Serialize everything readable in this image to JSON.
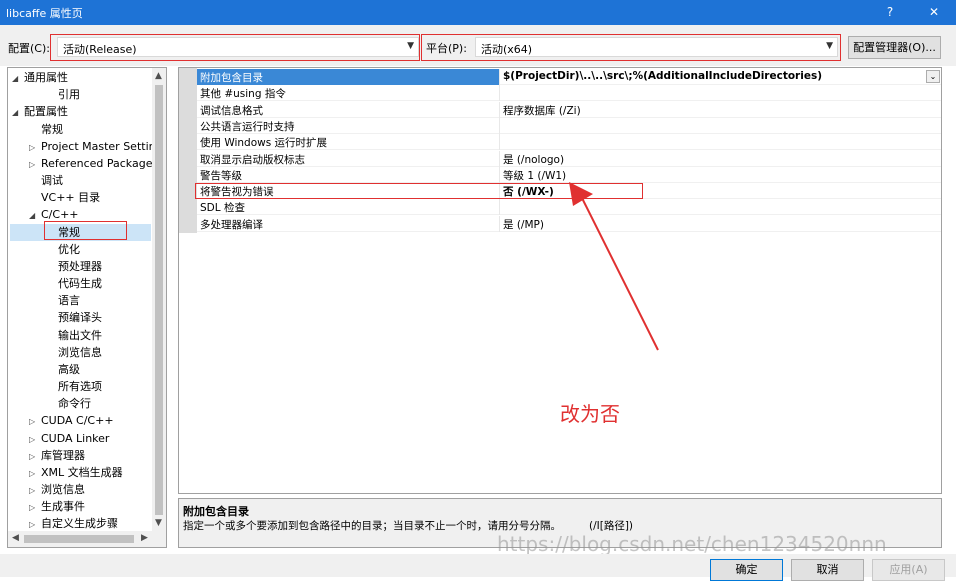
{
  "window": {
    "title": "libcaffe 属性页",
    "help_glyph": "?",
    "close_glyph": "✕"
  },
  "toolbar": {
    "config_label": "配置(C):",
    "config_value": "活动(Release)",
    "platform_label": "平台(P):",
    "platform_value": "活动(x64)",
    "config_manager_label": "配置管理器(O)..."
  },
  "tree": {
    "items": [
      {
        "label": "通用属性",
        "level": 0,
        "expander": "◢"
      },
      {
        "label": "引用",
        "level": 2,
        "expander": ""
      },
      {
        "label": "配置属性",
        "level": 0,
        "expander": "◢"
      },
      {
        "label": "常规",
        "level": 1,
        "expander": ""
      },
      {
        "label": "Project Master Settin",
        "level": 1,
        "expander": "▷"
      },
      {
        "label": "Referenced Packages",
        "level": 1,
        "expander": "▷"
      },
      {
        "label": "调试",
        "level": 1,
        "expander": ""
      },
      {
        "label": "VC++ 目录",
        "level": 1,
        "expander": ""
      },
      {
        "label": "C/C++",
        "level": 1,
        "expander": "◢"
      },
      {
        "label": "常规",
        "level": 2,
        "expander": "",
        "selected": true
      },
      {
        "label": "优化",
        "level": 2,
        "expander": ""
      },
      {
        "label": "预处理器",
        "level": 2,
        "expander": ""
      },
      {
        "label": "代码生成",
        "level": 2,
        "expander": ""
      },
      {
        "label": "语言",
        "level": 2,
        "expander": ""
      },
      {
        "label": "预编译头",
        "level": 2,
        "expander": ""
      },
      {
        "label": "输出文件",
        "level": 2,
        "expander": ""
      },
      {
        "label": "浏览信息",
        "level": 2,
        "expander": ""
      },
      {
        "label": "高级",
        "level": 2,
        "expander": ""
      },
      {
        "label": "所有选项",
        "level": 2,
        "expander": ""
      },
      {
        "label": "命令行",
        "level": 2,
        "expander": ""
      },
      {
        "label": "CUDA C/C++",
        "level": 1,
        "expander": "▷"
      },
      {
        "label": "CUDA Linker",
        "level": 1,
        "expander": "▷"
      },
      {
        "label": "库管理器",
        "level": 1,
        "expander": "▷"
      },
      {
        "label": "XML 文档生成器",
        "level": 1,
        "expander": "▷"
      },
      {
        "label": "浏览信息",
        "level": 1,
        "expander": "▷"
      },
      {
        "label": "生成事件",
        "level": 1,
        "expander": "▷"
      },
      {
        "label": "自定义生成步骤",
        "level": 1,
        "expander": "▷"
      }
    ]
  },
  "grid": {
    "rows": [
      {
        "name": "附加包含目录",
        "value": "$(ProjectDir)\\..\\..\\src\\;%(AdditionalIncludeDirectories)",
        "selected": true,
        "bold": true,
        "dropdown": "⌄"
      },
      {
        "name": "其他 #using 指令",
        "value": ""
      },
      {
        "name": "调试信息格式",
        "value": "程序数据库 (/Zi)"
      },
      {
        "name": "公共语言运行时支持",
        "value": ""
      },
      {
        "name": "使用 Windows 运行时扩展",
        "value": ""
      },
      {
        "name": "取消显示启动版权标志",
        "value": "是 (/nologo)"
      },
      {
        "name": "警告等级",
        "value": "等级 1 (/W1)"
      },
      {
        "name": "将警告视为错误",
        "value": "否 (/WX-)",
        "bold": true
      },
      {
        "name": "SDL 检查",
        "value": ""
      },
      {
        "name": "多处理器编译",
        "value": "是 (/MP)"
      }
    ]
  },
  "description": {
    "title": "附加包含目录",
    "text": "指定一个或多个要添加到包含路径中的目录；当目录不止一个时，请用分号分隔。",
    "switch": "(/I[路径])"
  },
  "annotation": "改为否",
  "watermark": "https://blog.csdn.net/chen1234520nnn",
  "buttons": {
    "ok": "确定",
    "cancel": "取消",
    "apply": "应用(A)"
  },
  "colors": {
    "title_bar": "#1e73d6",
    "selection": "#3a88d6",
    "tree_selection": "#cce4f7",
    "annotation": "#e03030"
  }
}
